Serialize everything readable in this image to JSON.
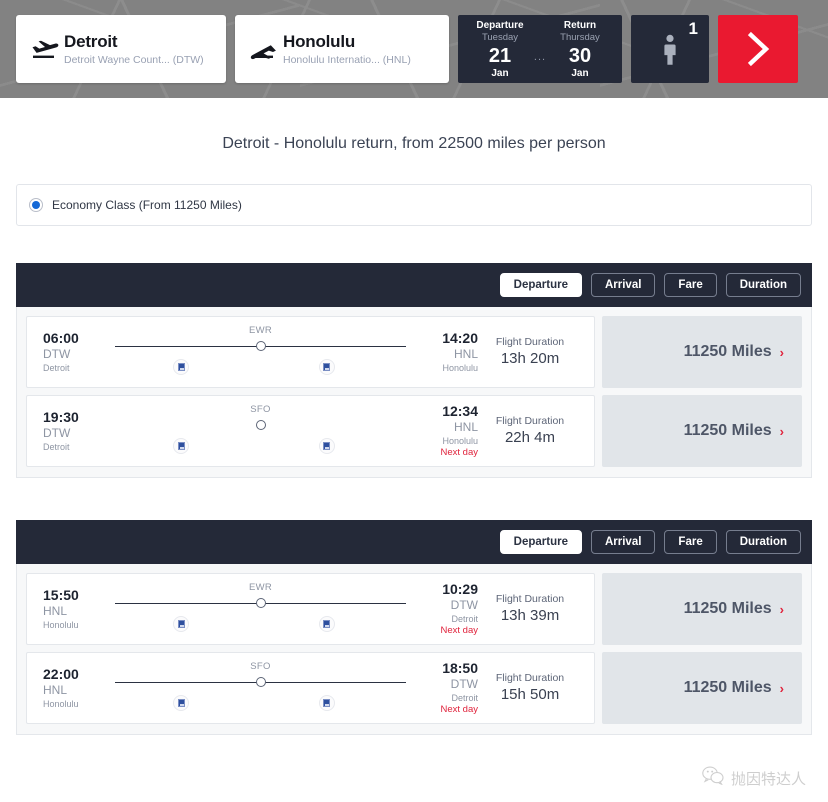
{
  "search_bar": {
    "origin": {
      "city": "Detroit",
      "airport": "Detroit Wayne Count... (DTW)",
      "icon": "plane-departure-icon"
    },
    "destination": {
      "city": "Honolulu",
      "airport": "Honolulu Internatio... (HNL)",
      "icon": "plane-arrival-icon"
    },
    "dates": {
      "departure_label": "Departure",
      "departure_weekday": "Tuesday",
      "departure_day": "21",
      "departure_month": "Jan",
      "separator": "...",
      "return_label": "Return",
      "return_weekday": "Thursday",
      "return_day": "30",
      "return_month": "Jan"
    },
    "passengers": {
      "count": "1",
      "icon": "person-icon"
    },
    "submit": {
      "icon": "chevron-right-icon",
      "color": "#ea1930"
    }
  },
  "page_title": "Detroit - Honolulu return, from 22500 miles per person",
  "cabin": {
    "label": "Economy Class (From 11250 Miles)",
    "selected": true,
    "accent_color": "#1669d6"
  },
  "sort_tabs": [
    {
      "label": "Departure",
      "active": true
    },
    {
      "label": "Arrival",
      "active": false
    },
    {
      "label": "Fare",
      "active": false
    },
    {
      "label": "Duration",
      "active": false
    }
  ],
  "outbound": {
    "flights": [
      {
        "depart_time": "06:00",
        "depart_code": "DTW",
        "depart_city": "Detroit",
        "arrive_time": "14:20",
        "arrive_code": "HNL",
        "arrive_city": "Honolulu",
        "arrive_next_day": "",
        "stop": "EWR",
        "has_line": true,
        "duration_label": "Flight Duration",
        "duration": "13h 20m",
        "fare": "11250 Miles",
        "fare_chevron": "›"
      },
      {
        "depart_time": "19:30",
        "depart_code": "DTW",
        "depart_city": "Detroit",
        "arrive_time": "12:34",
        "arrive_code": "HNL",
        "arrive_city": "Honolulu",
        "arrive_next_day": "Next day",
        "stop": "SFO",
        "has_line": false,
        "duration_label": "Flight Duration",
        "duration": "22h 4m",
        "fare": "11250 Miles",
        "fare_chevron": "›"
      }
    ]
  },
  "inbound": {
    "flights": [
      {
        "depart_time": "15:50",
        "depart_code": "HNL",
        "depart_city": "Honolulu",
        "arrive_time": "10:29",
        "arrive_code": "DTW",
        "arrive_city": "Detroit",
        "arrive_next_day": "Next day",
        "stop": "EWR",
        "has_line": true,
        "duration_label": "Flight Duration",
        "duration": "13h 39m",
        "fare": "11250 Miles",
        "fare_chevron": "›"
      },
      {
        "depart_time": "22:00",
        "depart_code": "HNL",
        "depart_city": "Honolulu",
        "arrive_time": "18:50",
        "arrive_code": "DTW",
        "arrive_city": "Detroit",
        "arrive_next_day": "Next day",
        "stop": "SFO",
        "has_line": true,
        "duration_label": "Flight Duration",
        "duration": "15h 50m",
        "fare": "11250 Miles",
        "fare_chevron": "›"
      }
    ]
  },
  "watermark": {
    "text": "抛因特达人",
    "icon": "wechat-icon"
  }
}
